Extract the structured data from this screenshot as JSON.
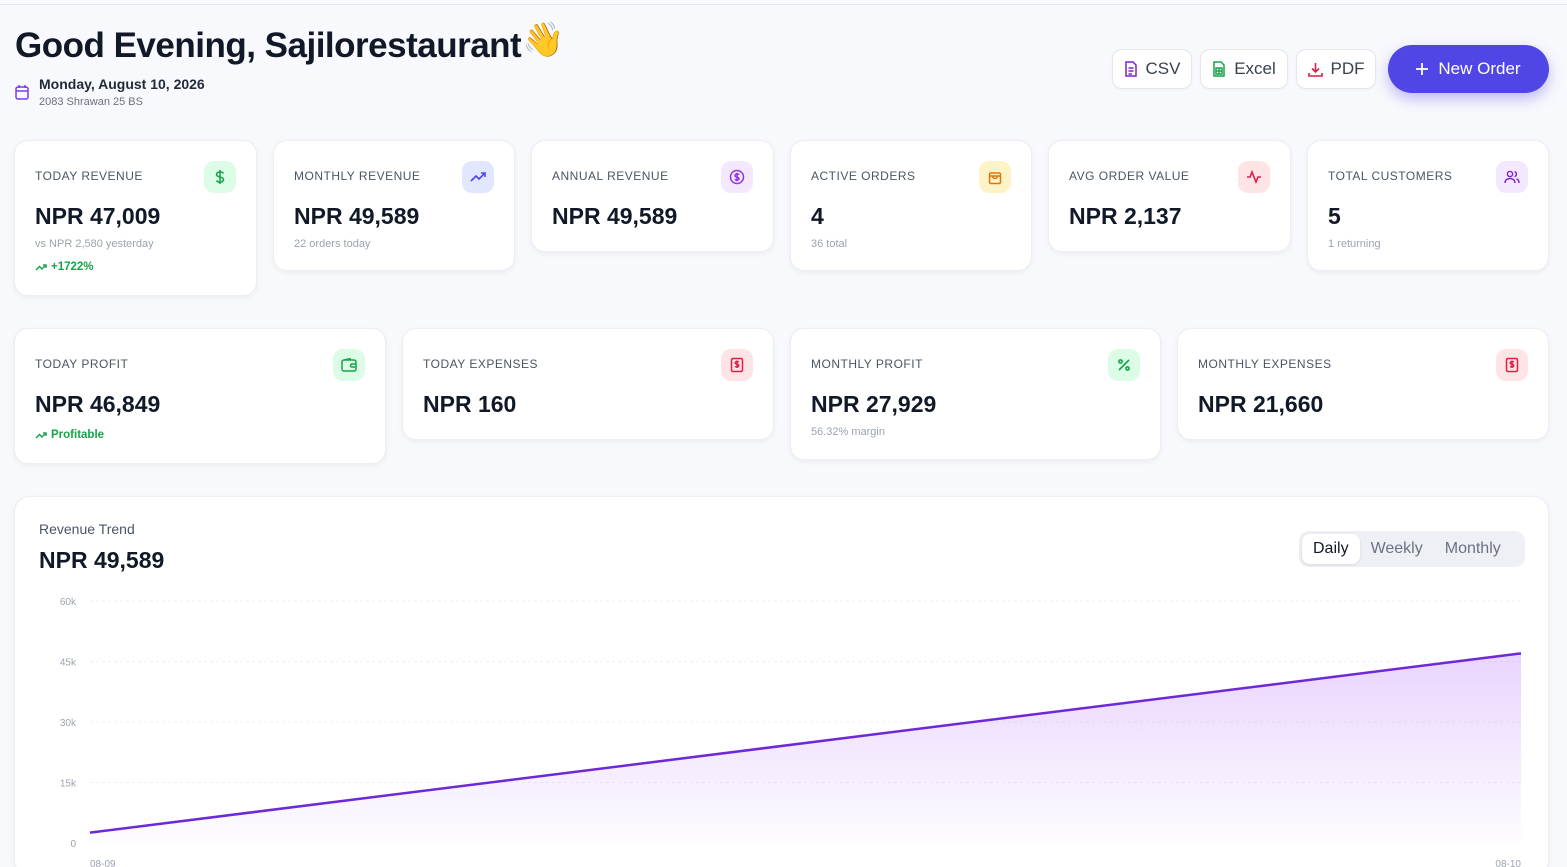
{
  "header": {
    "greeting": "Good Evening, Sajilorestaurant",
    "emoji": "👋",
    "date": "Monday, August 10, 2026",
    "nepali_date": "2083 Shrawan 25 BS"
  },
  "actions": {
    "csv": "CSV",
    "excel": "Excel",
    "pdf": "PDF",
    "new_order": "New Order"
  },
  "stats_row1": [
    {
      "label": "TODAY REVENUE",
      "value": "NPR 47,009",
      "sub": "vs NPR 2,580 yesterday",
      "trend": "+1722%",
      "icon": "dollar-icon",
      "icon_color": "#16a34a",
      "icon_bg": "#dcfce7"
    },
    {
      "label": "MONTHLY REVENUE",
      "value": "NPR 49,589",
      "sub": "22 orders today",
      "icon": "trending-up-icon",
      "icon_color": "#4f46e5",
      "icon_bg": "#e0e7ff"
    },
    {
      "label": "ANNUAL REVENUE",
      "value": "NPR 49,589",
      "icon": "coin-icon",
      "icon_color": "#9333ea",
      "icon_bg": "#f3e8ff"
    },
    {
      "label": "ACTIVE ORDERS",
      "value": "4",
      "sub": "36 total",
      "icon": "shopping-bag-icon",
      "icon_color": "#d97706",
      "icon_bg": "#fef3c7"
    },
    {
      "label": "AVG ORDER VALUE",
      "value": "NPR 2,137",
      "icon": "activity-icon",
      "icon_color": "#e11d48",
      "icon_bg": "#ffe4e6"
    },
    {
      "label": "TOTAL CUSTOMERS",
      "value": "5",
      "sub": "1 returning",
      "icon": "users-icon",
      "icon_color": "#7e22ce",
      "icon_bg": "#f3e8ff"
    }
  ],
  "stats_row2": [
    {
      "label": "TODAY PROFIT",
      "value": "NPR 46,849",
      "trend": "Profitable",
      "icon": "wallet-icon",
      "icon_color": "#16a34a",
      "icon_bg": "#dcfce7"
    },
    {
      "label": "TODAY EXPENSES",
      "value": "NPR 160",
      "icon": "receipt-icon",
      "icon_color": "#e11d48",
      "icon_bg": "#ffe4e6"
    },
    {
      "label": "MONTHLY PROFIT",
      "value": "NPR 27,929",
      "sub": "56.32% margin",
      "icon": "percent-icon",
      "icon_color": "#16a34a",
      "icon_bg": "#dcfce7"
    },
    {
      "label": "MONTHLY EXPENSES",
      "value": "NPR 21,660",
      "icon": "receipt-icon",
      "icon_color": "#e11d48",
      "icon_bg": "#ffe4e6"
    }
  ],
  "revenue_trend": {
    "title": "Revenue Trend",
    "total": "NPR 49,589",
    "tabs": [
      "Daily",
      "Weekly",
      "Monthly"
    ],
    "active_tab": "Daily"
  },
  "chart_data": {
    "type": "area",
    "x": [
      "08-09",
      "08-10"
    ],
    "values": [
      2580,
      47009
    ],
    "ylim": [
      0,
      60000
    ],
    "yticks": [
      "0",
      "15k",
      "30k",
      "45k",
      "60k"
    ],
    "ytick_values": [
      0,
      15000,
      30000,
      45000,
      60000
    ],
    "grid": true,
    "line_color": "#6d28d9"
  }
}
